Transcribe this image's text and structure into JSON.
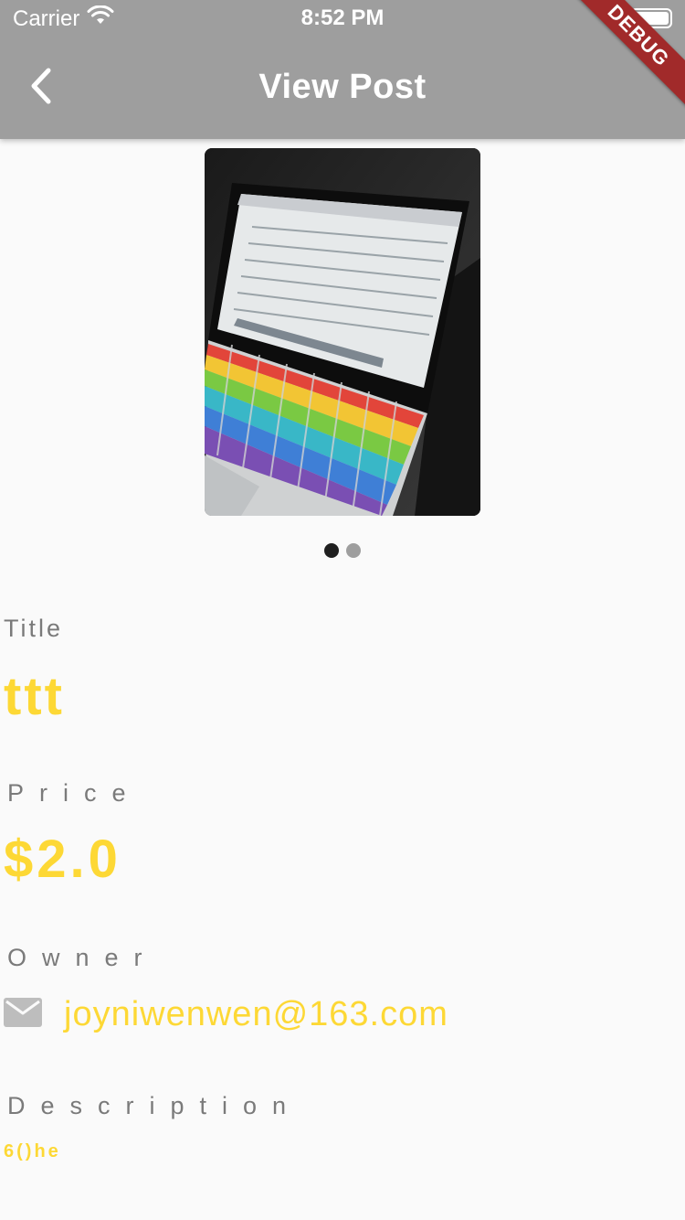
{
  "status_bar": {
    "carrier": "Carrier",
    "time": "8:52 PM",
    "wifi_icon": "wifi-icon",
    "battery_icon": "battery-icon"
  },
  "app_bar": {
    "title": "View Post",
    "back_icon": "chevron-left-icon",
    "debug_banner": "DEBUG"
  },
  "carousel": {
    "image": "laptop-with-rainbow-keyboard-photo",
    "page_count": 2,
    "active_index": 0
  },
  "post": {
    "title_label": "Title",
    "title_value": "ttt",
    "price_label": "Price",
    "price_value": "$2.0",
    "owner_label": "Owner",
    "owner_icon": "mail-icon",
    "owner_email": "joyniwenwen@163.com",
    "description_label": "Description",
    "description_value": "6()he"
  },
  "colors": {
    "app_bar": "#9e9e9e",
    "accent": "#fdd835",
    "label": "#7a7a7a",
    "background": "#fafafa",
    "debug_ribbon": "#a12a2a"
  }
}
